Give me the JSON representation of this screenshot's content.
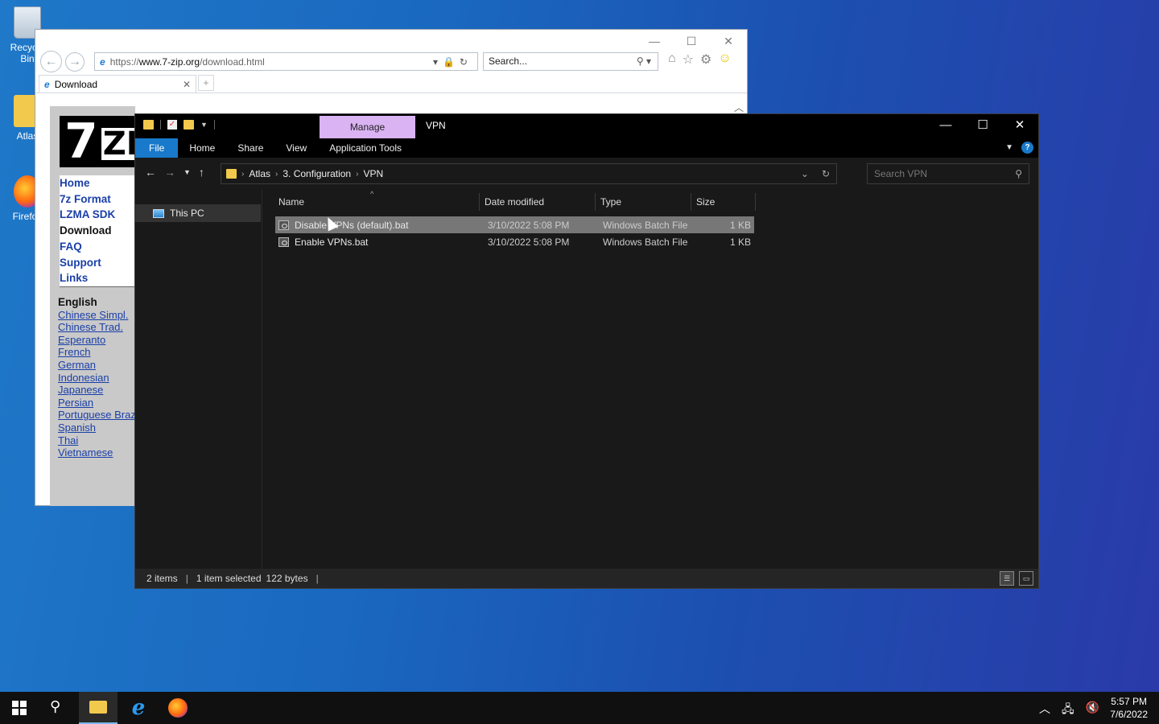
{
  "desktop": {
    "icons": [
      {
        "label": "Recycle Bin",
        "icon": "recycle-bin-icon"
      },
      {
        "label": "Atlas",
        "icon": "folder-icon"
      },
      {
        "label": "Firefox",
        "icon": "firefox-icon"
      }
    ]
  },
  "browser": {
    "url_scheme": "https://",
    "url_host": "www.7-zip.org",
    "url_path": "/download.html",
    "search_placeholder": "Search...",
    "tab_title": "Download",
    "page": {
      "logo_main": "7",
      "logo_rest": "ZIP",
      "nav": [
        "Home",
        "7z Format",
        "LZMA SDK",
        "Download",
        "FAQ",
        "Support",
        "Links"
      ],
      "nav_current": "Download",
      "language_current": "English",
      "languages": [
        "Chinese Simpl.",
        "Chinese Trad.",
        "Esperanto",
        "French",
        "German",
        "Indonesian",
        "Japanese",
        "Persian",
        "Portuguese Brazil",
        "Spanish",
        "Thai",
        "Vietnamese"
      ]
    }
  },
  "explorer": {
    "context_tab": "Manage",
    "title": "VPN",
    "ribbon_tabs": [
      "File",
      "Home",
      "Share",
      "View",
      "Application Tools"
    ],
    "breadcrumb": [
      "Atlas",
      "3. Configuration",
      "VPN"
    ],
    "search_placeholder": "Search VPN",
    "nav_items": [
      "This PC"
    ],
    "columns": [
      "Name",
      "Date modified",
      "Type",
      "Size"
    ],
    "files": [
      {
        "name": "Disable VPNs (default).bat",
        "date": "3/10/2022 5:08 PM",
        "type": "Windows Batch File",
        "size": "1 KB",
        "selected": true
      },
      {
        "name": "Enable VPNs.bat",
        "date": "3/10/2022 5:08 PM",
        "type": "Windows Batch File",
        "size": "1 KB",
        "selected": false
      }
    ],
    "status": {
      "count": "2 items",
      "selection": "1 item selected",
      "bytes": "122 bytes"
    }
  },
  "taskbar": {
    "time": "5:57 PM",
    "date": "7/6/2022"
  }
}
